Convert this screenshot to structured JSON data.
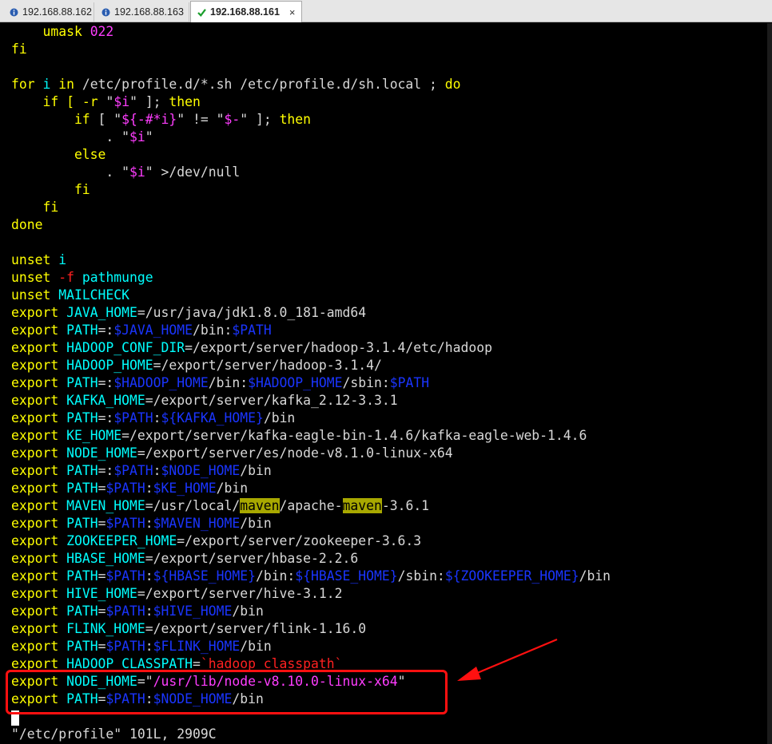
{
  "tabs": [
    {
      "label": "192.168.88.162",
      "icon": "info-icon",
      "active": false
    },
    {
      "label": "192.168.88.163",
      "icon": "info-icon",
      "active": false
    },
    {
      "label": "192.168.88.161",
      "icon": "check-icon",
      "active": true,
      "close": "×"
    }
  ],
  "lines": [
    [
      {
        "t": "    umask ",
        "c": "y"
      },
      {
        "t": "022",
        "c": "m"
      }
    ],
    [
      {
        "t": "fi",
        "c": "y"
      }
    ],
    [],
    [
      {
        "t": "for",
        "c": "y"
      },
      {
        "t": " i ",
        "c": "c"
      },
      {
        "t": "in",
        "c": "y"
      },
      {
        "t": " /etc/profile.d/*.sh /etc/profile.d/sh.local ; ",
        "c": "w"
      },
      {
        "t": "do",
        "c": "y"
      }
    ],
    [
      {
        "t": "    if",
        "c": "y"
      },
      {
        "t": " [ ",
        "c": "y"
      },
      {
        "t": "-r",
        "c": "y"
      },
      {
        "t": " \"",
        "c": "w"
      },
      {
        "t": "$i",
        "c": "m"
      },
      {
        "t": "\" ]; ",
        "c": "w"
      },
      {
        "t": "then",
        "c": "y"
      }
    ],
    [
      {
        "t": "        if",
        "c": "y"
      },
      {
        "t": " [ \"",
        "c": "w"
      },
      {
        "t": "${-#*i}",
        "c": "m"
      },
      {
        "t": "\" != \"",
        "c": "w"
      },
      {
        "t": "$-",
        "c": "m"
      },
      {
        "t": "\" ]; ",
        "c": "w"
      },
      {
        "t": "then",
        "c": "y"
      }
    ],
    [
      {
        "t": "            . \"",
        "c": "w"
      },
      {
        "t": "$i",
        "c": "m"
      },
      {
        "t": "\"",
        "c": "w"
      }
    ],
    [
      {
        "t": "        else",
        "c": "y"
      }
    ],
    [
      {
        "t": "            . \"",
        "c": "w"
      },
      {
        "t": "$i",
        "c": "m"
      },
      {
        "t": "\" >/dev/null",
        "c": "w"
      }
    ],
    [
      {
        "t": "        fi",
        "c": "y"
      }
    ],
    [
      {
        "t": "    fi",
        "c": "y"
      }
    ],
    [
      {
        "t": "done",
        "c": "y"
      }
    ],
    [],
    [
      {
        "t": "unset",
        "c": "y"
      },
      {
        "t": " i",
        "c": "c"
      }
    ],
    [
      {
        "t": "unset",
        "c": "y"
      },
      {
        "t": " ",
        "c": "w"
      },
      {
        "t": "-f",
        "c": "r"
      },
      {
        "t": " pathmunge",
        "c": "c"
      }
    ],
    [
      {
        "t": "unset",
        "c": "y"
      },
      {
        "t": " MAILCHECK",
        "c": "c"
      }
    ],
    [
      {
        "t": "export",
        "c": "y"
      },
      {
        "t": " JAVA_HOME",
        "c": "c"
      },
      {
        "t": "=/usr/java/jdk1.8.0_181-amd64",
        "c": "w"
      }
    ],
    [
      {
        "t": "export",
        "c": "y"
      },
      {
        "t": " PATH",
        "c": "c"
      },
      {
        "t": "=:",
        "c": "w"
      },
      {
        "t": "$JAVA_HOME",
        "c": "b"
      },
      {
        "t": "/bin:",
        "c": "w"
      },
      {
        "t": "$PATH",
        "c": "b"
      }
    ],
    [
      {
        "t": "export",
        "c": "y"
      },
      {
        "t": " HADOOP_CONF_DIR",
        "c": "c"
      },
      {
        "t": "=/export/server/hadoop-3.1.4/etc/hadoop",
        "c": "w"
      }
    ],
    [
      {
        "t": "export",
        "c": "y"
      },
      {
        "t": " HADOOP_HOME",
        "c": "c"
      },
      {
        "t": "=/export/server/hadoop-3.1.4/",
        "c": "w"
      }
    ],
    [
      {
        "t": "export",
        "c": "y"
      },
      {
        "t": " PATH",
        "c": "c"
      },
      {
        "t": "=:",
        "c": "w"
      },
      {
        "t": "$HADOOP_HOME",
        "c": "b"
      },
      {
        "t": "/bin:",
        "c": "w"
      },
      {
        "t": "$HADOOP_HOME",
        "c": "b"
      },
      {
        "t": "/sbin:",
        "c": "w"
      },
      {
        "t": "$PATH",
        "c": "b"
      }
    ],
    [
      {
        "t": "export",
        "c": "y"
      },
      {
        "t": " KAFKA_HOME",
        "c": "c"
      },
      {
        "t": "=/export/server/kafka_2.12-3.3.1",
        "c": "w"
      }
    ],
    [
      {
        "t": "export",
        "c": "y"
      },
      {
        "t": " PATH",
        "c": "c"
      },
      {
        "t": "=:",
        "c": "w"
      },
      {
        "t": "$PATH",
        "c": "b"
      },
      {
        "t": ":",
        "c": "w"
      },
      {
        "t": "${KAFKA_HOME}",
        "c": "b"
      },
      {
        "t": "/bin",
        "c": "w"
      }
    ],
    [
      {
        "t": "export",
        "c": "y"
      },
      {
        "t": " KE_HOME",
        "c": "c"
      },
      {
        "t": "=/export/server/kafka-eagle-bin-1.4.6/kafka-eagle-web-1.4.6",
        "c": "w"
      }
    ],
    [
      {
        "t": "export",
        "c": "y"
      },
      {
        "t": " NODE_HOME",
        "c": "c"
      },
      {
        "t": "=/export/server/es/node-v8.1.0-linux-x64",
        "c": "w"
      }
    ],
    [
      {
        "t": "export",
        "c": "y"
      },
      {
        "t": " PATH",
        "c": "c"
      },
      {
        "t": "=:",
        "c": "w"
      },
      {
        "t": "$PATH",
        "c": "b"
      },
      {
        "t": ":",
        "c": "w"
      },
      {
        "t": "$NODE_HOME",
        "c": "b"
      },
      {
        "t": "/bin",
        "c": "w"
      }
    ],
    [
      {
        "t": "export",
        "c": "y"
      },
      {
        "t": " PATH",
        "c": "c"
      },
      {
        "t": "=",
        "c": "w"
      },
      {
        "t": "$PATH",
        "c": "b"
      },
      {
        "t": ":",
        "c": "w"
      },
      {
        "t": "$KE_HOME",
        "c": "b"
      },
      {
        "t": "/bin",
        "c": "w"
      }
    ],
    [
      {
        "t": "export",
        "c": "y"
      },
      {
        "t": " MAVEN_HOME",
        "c": "c"
      },
      {
        "t": "=/usr/local/",
        "c": "w"
      },
      {
        "t": "maven",
        "c": "hl"
      },
      {
        "t": "/apache-",
        "c": "w"
      },
      {
        "t": "maven",
        "c": "hl"
      },
      {
        "t": "-3.6.1",
        "c": "w"
      }
    ],
    [
      {
        "t": "export",
        "c": "y"
      },
      {
        "t": " PATH",
        "c": "c"
      },
      {
        "t": "=",
        "c": "w"
      },
      {
        "t": "$PATH",
        "c": "b"
      },
      {
        "t": ":",
        "c": "w"
      },
      {
        "t": "$MAVEN_HOME",
        "c": "b"
      },
      {
        "t": "/bin",
        "c": "w"
      }
    ],
    [
      {
        "t": "export",
        "c": "y"
      },
      {
        "t": " ZOOKEEPER_HOME",
        "c": "c"
      },
      {
        "t": "=/export/server/zookeeper-3.6.3",
        "c": "w"
      }
    ],
    [
      {
        "t": "export",
        "c": "y"
      },
      {
        "t": " HBASE_HOME",
        "c": "c"
      },
      {
        "t": "=/export/server/hbase-2.2.6",
        "c": "w"
      }
    ],
    [
      {
        "t": "export",
        "c": "y"
      },
      {
        "t": " PATH",
        "c": "c"
      },
      {
        "t": "=",
        "c": "w"
      },
      {
        "t": "$PATH",
        "c": "b"
      },
      {
        "t": ":",
        "c": "w"
      },
      {
        "t": "${HBASE_HOME}",
        "c": "b"
      },
      {
        "t": "/bin:",
        "c": "w"
      },
      {
        "t": "${HBASE_HOME}",
        "c": "b"
      },
      {
        "t": "/sbin:",
        "c": "w"
      },
      {
        "t": "${ZOOKEEPER_HOME}",
        "c": "b"
      },
      {
        "t": "/bin",
        "c": "w"
      }
    ],
    [
      {
        "t": "export",
        "c": "y"
      },
      {
        "t": " HIVE_HOME",
        "c": "c"
      },
      {
        "t": "=/export/server/hive-3.1.2",
        "c": "w"
      }
    ],
    [
      {
        "t": "export",
        "c": "y"
      },
      {
        "t": " PATH",
        "c": "c"
      },
      {
        "t": "=",
        "c": "w"
      },
      {
        "t": "$PATH",
        "c": "b"
      },
      {
        "t": ":",
        "c": "w"
      },
      {
        "t": "$HIVE_HOME",
        "c": "b"
      },
      {
        "t": "/bin",
        "c": "w"
      }
    ],
    [
      {
        "t": "export",
        "c": "y"
      },
      {
        "t": " FLINK_HOME",
        "c": "c"
      },
      {
        "t": "=/export/server/flink-1.16.0",
        "c": "w"
      }
    ],
    [
      {
        "t": "export",
        "c": "y"
      },
      {
        "t": " PATH",
        "c": "c"
      },
      {
        "t": "=",
        "c": "w"
      },
      {
        "t": "$PATH",
        "c": "b"
      },
      {
        "t": ":",
        "c": "w"
      },
      {
        "t": "$FLINK_HOME",
        "c": "b"
      },
      {
        "t": "/bin",
        "c": "w"
      }
    ],
    [
      {
        "t": "export",
        "c": "y"
      },
      {
        "t": " HADOOP_CLASSPATH",
        "c": "c"
      },
      {
        "t": "=",
        "c": "w"
      },
      {
        "t": "`hadoop classpath`",
        "c": "r"
      }
    ],
    [
      {
        "t": "export",
        "c": "y"
      },
      {
        "t": " NODE_HOME",
        "c": "c"
      },
      {
        "t": "=\"",
        "c": "w"
      },
      {
        "t": "/usr/lib/node-v8.10.0-linux-x64",
        "c": "m"
      },
      {
        "t": "\"",
        "c": "w"
      }
    ],
    [
      {
        "t": "export",
        "c": "y"
      },
      {
        "t": " PATH",
        "c": "c"
      },
      {
        "t": "=",
        "c": "w"
      },
      {
        "t": "$PATH",
        "c": "b"
      },
      {
        "t": ":",
        "c": "w"
      },
      {
        "t": "$NODE_HOME",
        "c": "b"
      },
      {
        "t": "/bin",
        "c": "w"
      }
    ],
    [],
    [
      {
        "t": "\"/etc/profile\" 101L, 2909C",
        "c": "w"
      }
    ]
  ],
  "colors": {
    "keyword": "#ffff00",
    "variable_name": "#00ffff",
    "string": "#ff3dff",
    "expansion": "#1a35ff",
    "plain": "#d8d8d8",
    "option": "#ff2020",
    "search_highlight": "#a8a800",
    "annotation": "#ff1010"
  },
  "annotation": {
    "type": "red-rectangle-with-arrow",
    "target_lines": [
      37,
      38
    ]
  }
}
